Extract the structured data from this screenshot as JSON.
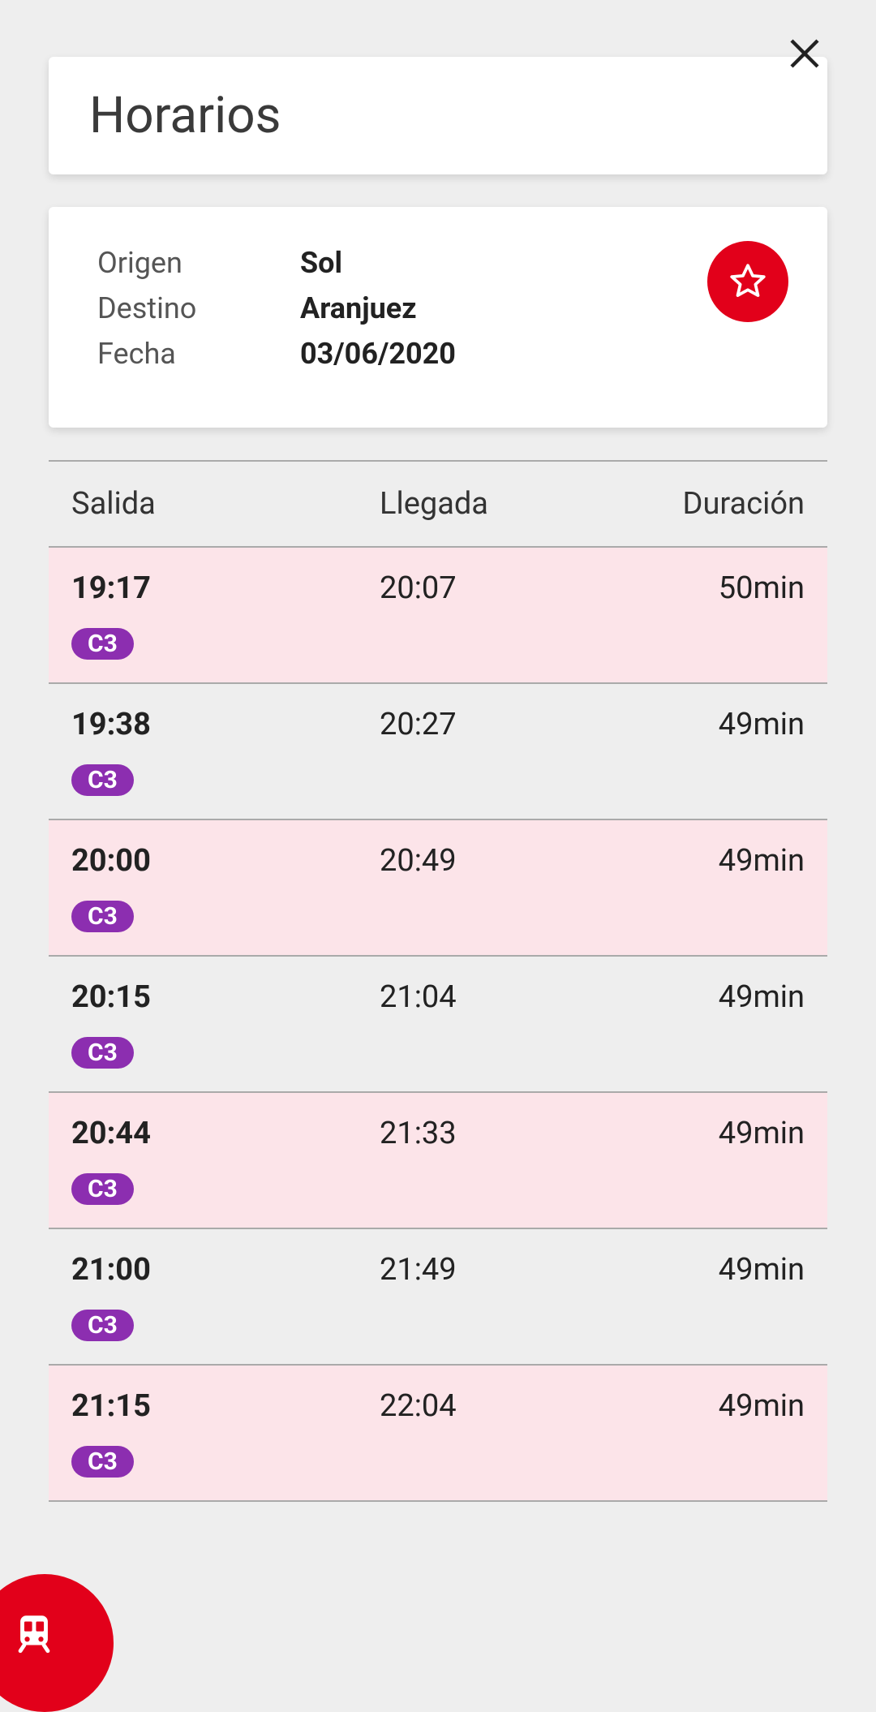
{
  "title": "Horarios",
  "labels": {
    "origin": "Origen",
    "destination": "Destino",
    "date": "Fecha"
  },
  "values": {
    "origin": "Sol",
    "destination": "Aranjuez",
    "date": "03/06/2020"
  },
  "columns": {
    "departure": "Salida",
    "arrival": "Llegada",
    "duration": "Duración"
  },
  "rows": [
    {
      "departure": "19:17",
      "arrival": "20:07",
      "duration": "50min",
      "line": "C3",
      "alt": true
    },
    {
      "departure": "19:38",
      "arrival": "20:27",
      "duration": "49min",
      "line": "C3",
      "alt": false
    },
    {
      "departure": "20:00",
      "arrival": "20:49",
      "duration": "49min",
      "line": "C3",
      "alt": true
    },
    {
      "departure": "20:15",
      "arrival": "21:04",
      "duration": "49min",
      "line": "C3",
      "alt": false
    },
    {
      "departure": "20:44",
      "arrival": "21:33",
      "duration": "49min",
      "line": "C3",
      "alt": true
    },
    {
      "departure": "21:00",
      "arrival": "21:49",
      "duration": "49min",
      "line": "C3",
      "alt": false
    },
    {
      "departure": "21:15",
      "arrival": "22:04",
      "duration": "49min",
      "line": "C3",
      "alt": true
    }
  ],
  "icons": {
    "close": "close-icon",
    "favorite": "star-icon",
    "fab": "train-icon"
  },
  "colors": {
    "accent": "#e2001a",
    "line": "#8c2eb0",
    "rowAlt": "#fce4e9"
  }
}
